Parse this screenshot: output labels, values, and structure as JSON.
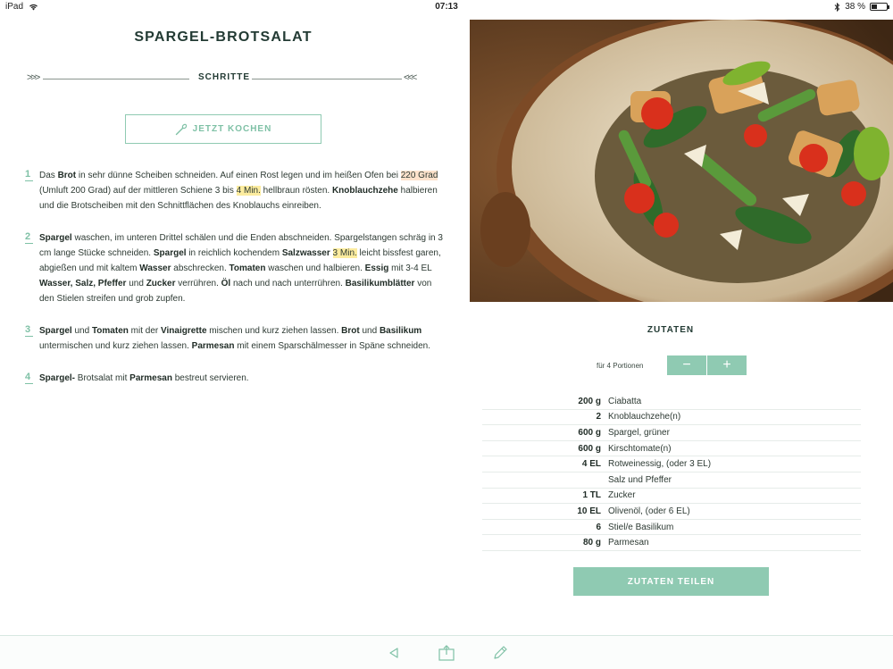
{
  "status_bar": {
    "device": "iPad",
    "time": "07:13",
    "battery": "38 %",
    "battery_level": 0.38
  },
  "recipe": {
    "title": "SPARGEL-BROTSALAT"
  },
  "steps_section": {
    "label": "SCHRITTE",
    "cook_button": "JETZT KOCHEN",
    "steps": [
      {
        "number": "1",
        "segments": [
          {
            "t": "Das "
          },
          {
            "t": "Brot",
            "b": true
          },
          {
            "t": " in sehr dünne Scheiben schneiden. Auf einen Rost legen und im heißen Ofen bei "
          },
          {
            "t": "220 Grad",
            "hl": "orange"
          },
          {
            "t": " (Umluft 200 Grad) auf der mittleren Schiene 3 bis "
          },
          {
            "t": "4 Min.",
            "hl": "yellow"
          },
          {
            "t": " hellbraun rösten. "
          },
          {
            "t": "Knoblauchzehe",
            "b": true
          },
          {
            "t": " halbieren und die Brotscheiben mit den Schnittflächen des Knoblauchs einreiben."
          }
        ]
      },
      {
        "number": "2",
        "segments": [
          {
            "t": "Spargel",
            "b": true
          },
          {
            "t": " waschen, im unteren Drittel schälen und die Enden abschneiden. Spargelstangen schräg in 3 cm lange Stücke schneiden. "
          },
          {
            "t": "Spargel",
            "b": true
          },
          {
            "t": " in reichlich kochendem "
          },
          {
            "t": "Salzwasser",
            "b": true
          },
          {
            "t": " "
          },
          {
            "t": "3 Min.",
            "hl": "yellow"
          },
          {
            "t": " leicht bissfest garen, abgießen und mit kaltem "
          },
          {
            "t": "Wasser",
            "b": true
          },
          {
            "t": " abschrecken. "
          },
          {
            "t": "Tomaten",
            "b": true
          },
          {
            "t": " waschen und halbieren. "
          },
          {
            "t": "Essig",
            "b": true
          },
          {
            "t": " mit 3-4 EL "
          },
          {
            "t": "Wasser, Salz, Pfeffer",
            "b": true
          },
          {
            "t": " und "
          },
          {
            "t": "Zucker",
            "b": true
          },
          {
            "t": " verrühren. "
          },
          {
            "t": "Öl",
            "b": true
          },
          {
            "t": " nach und nach unterrühren. "
          },
          {
            "t": "Basilikumblätter",
            "b": true
          },
          {
            "t": " von den Stielen streifen und grob zupfen."
          }
        ]
      },
      {
        "number": "3",
        "segments": [
          {
            "t": "Spargel",
            "b": true
          },
          {
            "t": " und "
          },
          {
            "t": "Tomaten",
            "b": true
          },
          {
            "t": " mit der "
          },
          {
            "t": "Vinaigrette",
            "b": true
          },
          {
            "t": " mischen und kurz ziehen lassen. "
          },
          {
            "t": "Brot",
            "b": true
          },
          {
            "t": " und "
          },
          {
            "t": "Basilikum",
            "b": true
          },
          {
            "t": " untermischen und kurz ziehen lassen. "
          },
          {
            "t": "Parmesan",
            "b": true
          },
          {
            "t": " mit einem Sparschälmesser in Späne schneiden."
          }
        ]
      },
      {
        "number": "4",
        "segments": [
          {
            "t": "Spargel-",
            "b": true
          },
          {
            "t": " Brotsalat mit "
          },
          {
            "t": "Parmesan",
            "b": true
          },
          {
            "t": " bestreut servieren."
          }
        ]
      }
    ]
  },
  "ingredients_section": {
    "label": "ZUTATEN",
    "portions_label": "für 4 Portionen",
    "minus": "−",
    "plus": "+",
    "items": [
      {
        "qty": "200 g",
        "name": "Ciabatta"
      },
      {
        "qty": "2",
        "name": "Knoblauchzehe(n)"
      },
      {
        "qty": "600 g",
        "name": "Spargel, grüner"
      },
      {
        "qty": "600 g",
        "name": "Kirschtomate(n)"
      },
      {
        "qty": "4 EL",
        "name": "Rotweinessig, (oder 3 EL)"
      },
      {
        "qty": "",
        "name": "Salz und Pfeffer"
      },
      {
        "qty": "1 TL",
        "name": "Zucker"
      },
      {
        "qty": "10 EL",
        "name": "Olivenöl, (oder 6 EL)"
      },
      {
        "qty": "6",
        "name": "Stiel/e Basilikum"
      },
      {
        "qty": "80 g",
        "name": "Parmesan"
      }
    ],
    "share_button": "ZUTATEN TEILEN"
  },
  "toolbar": {
    "icons": [
      "back-icon",
      "share-icon",
      "edit-icon"
    ]
  },
  "colors": {
    "accent": "#8fcab2",
    "title": "#233b34",
    "highlight_orange": "#fde2cb",
    "highlight_yellow": "#fcec9f"
  }
}
